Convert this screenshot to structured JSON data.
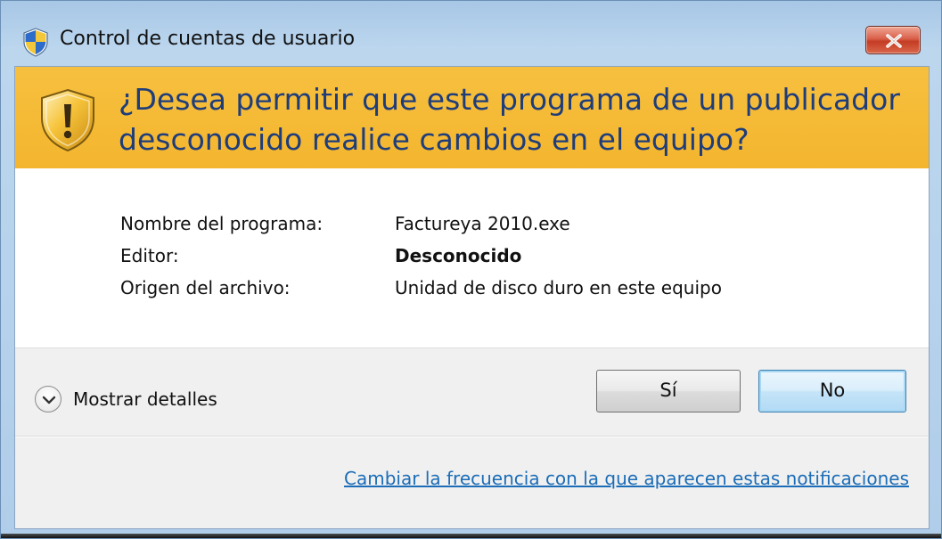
{
  "window": {
    "title": "Control de cuentas de usuario",
    "title_icon": "uac-shield-icon",
    "close_icon": "close-icon"
  },
  "banner": {
    "icon": "warning-shield-icon",
    "headline": "¿Desea permitir que este programa de un publicador desconocido realice cambios en el equipo?",
    "background_color": "#f5b935",
    "text_color": "#1f3d7a"
  },
  "info": {
    "rows": [
      {
        "label": "Nombre del programa:",
        "value": "Factureya 2010.exe"
      },
      {
        "label": "Editor:",
        "value": "Desconocido"
      },
      {
        "label": "Origen del archivo:",
        "value": "Unidad de disco duro en este equipo"
      }
    ]
  },
  "footer": {
    "details_label": "Mostrar detalles",
    "details_icon": "chevron-down-icon",
    "yes_label": "Sí",
    "no_label": "No",
    "link_text": "Cambiar la frecuencia con la que aparecen estas notificaciones",
    "link_color": "#1b6db8"
  }
}
